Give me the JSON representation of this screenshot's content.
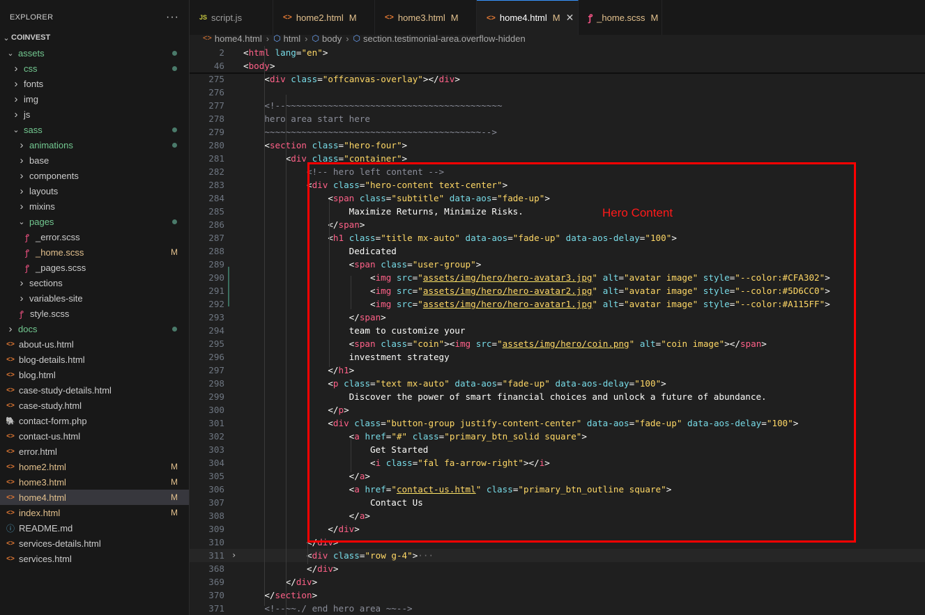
{
  "sidebar": {
    "title": "EXPLORER",
    "more": "···",
    "root": "COINVEST",
    "items": [
      {
        "label": "assets",
        "type": "folder-open",
        "depth": 1,
        "status": "dir-mod"
      },
      {
        "label": "css",
        "type": "folder",
        "depth": 2,
        "status": "dir-mod"
      },
      {
        "label": "fonts",
        "type": "folder",
        "depth": 2,
        "status": "plain"
      },
      {
        "label": "img",
        "type": "folder",
        "depth": 2,
        "status": "plain"
      },
      {
        "label": "js",
        "type": "folder",
        "depth": 2,
        "status": "plain"
      },
      {
        "label": "sass",
        "type": "folder-open",
        "depth": 2,
        "status": "dir-mod"
      },
      {
        "label": "animations",
        "type": "folder",
        "depth": 3,
        "status": "dir-mod"
      },
      {
        "label": "base",
        "type": "folder",
        "depth": 3,
        "status": "plain"
      },
      {
        "label": "components",
        "type": "folder",
        "depth": 3,
        "status": "plain"
      },
      {
        "label": "layouts",
        "type": "folder",
        "depth": 3,
        "status": "plain"
      },
      {
        "label": "mixins",
        "type": "folder",
        "depth": 3,
        "status": "plain"
      },
      {
        "label": "pages",
        "type": "folder-open",
        "depth": 3,
        "status": "dir-mod"
      },
      {
        "label": "_error.scss",
        "type": "scss",
        "depth": 4,
        "status": "plain"
      },
      {
        "label": "_home.scss",
        "type": "scss",
        "depth": 4,
        "status": "mod",
        "badge": "M"
      },
      {
        "label": "_pages.scss",
        "type": "scss",
        "depth": 4,
        "status": "plain"
      },
      {
        "label": "sections",
        "type": "folder",
        "depth": 3,
        "status": "plain"
      },
      {
        "label": "variables-site",
        "type": "folder",
        "depth": 3,
        "status": "plain"
      },
      {
        "label": "style.scss",
        "type": "scss",
        "depth": 3,
        "status": "plain"
      },
      {
        "label": "docs",
        "type": "folder",
        "depth": 1,
        "status": "dir-mod"
      },
      {
        "label": "about-us.html",
        "type": "html",
        "depth": 1,
        "status": "plain"
      },
      {
        "label": "blog-details.html",
        "type": "html",
        "depth": 1,
        "status": "plain"
      },
      {
        "label": "blog.html",
        "type": "html",
        "depth": 1,
        "status": "plain"
      },
      {
        "label": "case-study-details.html",
        "type": "html",
        "depth": 1,
        "status": "plain"
      },
      {
        "label": "case-study.html",
        "type": "html",
        "depth": 1,
        "status": "plain"
      },
      {
        "label": "contact-form.php",
        "type": "php",
        "depth": 1,
        "status": "plain"
      },
      {
        "label": "contact-us.html",
        "type": "html",
        "depth": 1,
        "status": "plain"
      },
      {
        "label": "error.html",
        "type": "html",
        "depth": 1,
        "status": "plain"
      },
      {
        "label": "home2.html",
        "type": "html",
        "depth": 1,
        "status": "mod",
        "badge": "M"
      },
      {
        "label": "home3.html",
        "type": "html",
        "depth": 1,
        "status": "mod",
        "badge": "M"
      },
      {
        "label": "home4.html",
        "type": "html",
        "depth": 1,
        "status": "mod",
        "badge": "M",
        "selected": true
      },
      {
        "label": "index.html",
        "type": "html",
        "depth": 1,
        "status": "mod",
        "badge": "M"
      },
      {
        "label": "README.md",
        "type": "info",
        "depth": 1,
        "status": "plain"
      },
      {
        "label": "services-details.html",
        "type": "html",
        "depth": 1,
        "status": "plain"
      },
      {
        "label": "services.html",
        "type": "html",
        "depth": 1,
        "status": "plain"
      }
    ]
  },
  "tabs": [
    {
      "label": "script.js",
      "icon": "JS",
      "modified": ""
    },
    {
      "label": "home2.html",
      "icon": "<>",
      "modified": "M"
    },
    {
      "label": "home3.html",
      "icon": "<>",
      "modified": "M"
    },
    {
      "label": "home4.html",
      "icon": "<>",
      "modified": "M",
      "active": true,
      "close": "✕"
    },
    {
      "label": "_home.scss",
      "icon": "scss",
      "modified": "M"
    }
  ],
  "breadcrumb": [
    "home4.html",
    "html",
    "body",
    "section.testimonial-area.overflow-hidden"
  ],
  "annotation": "Hero Content",
  "code_lines": [
    {
      "n": "2",
      "t": "<html lang=\"en\">",
      "sticky": true
    },
    {
      "n": "46",
      "t": "<body>",
      "sticky": true
    },
    {
      "n": "275",
      "t": "    <div class=\"offcanvas-overlay\"></div>"
    },
    {
      "n": "276",
      "t": ""
    },
    {
      "n": "277",
      "t": "    <!--~~~~~~~~~~~~~~~~~~~~~~~~~~~~~~~~~~~~~~~~~"
    },
    {
      "n": "278",
      "t": "    hero area start here"
    },
    {
      "n": "279",
      "t": "    ~~~~~~~~~~~~~~~~~~~~~~~~~~~~~~~~~~~~~~~~~-->"
    },
    {
      "n": "280",
      "t": "    <section class=\"hero-four\">"
    },
    {
      "n": "281",
      "t": "        <div class=\"container\">"
    },
    {
      "n": "282",
      "t": "            <!-- hero left content -->"
    },
    {
      "n": "283",
      "t": "            <div class=\"hero-content text-center\">"
    },
    {
      "n": "284",
      "t": "                <span class=\"subtitle\" data-aos=\"fade-up\">"
    },
    {
      "n": "285",
      "t": "                    Maximize Returns, Minimize Risks."
    },
    {
      "n": "286",
      "t": "                </span>"
    },
    {
      "n": "287",
      "t": "                <h1 class=\"title mx-auto\" data-aos=\"fade-up\" data-aos-delay=\"100\">"
    },
    {
      "n": "288",
      "t": "                    Dedicated"
    },
    {
      "n": "289",
      "t": "                    <span class=\"user-group\">"
    },
    {
      "n": "290",
      "t": "                        <img src=\"assets/img/hero/hero-avatar3.jpg\" alt=\"avatar image\" style=\"--color:#CFA302\">"
    },
    {
      "n": "291",
      "t": "                        <img src=\"assets/img/hero/hero-avatar2.jpg\" alt=\"avatar image\" style=\"--color:#5D6CC0\">"
    },
    {
      "n": "292",
      "t": "                        <img src=\"assets/img/hero/hero-avatar1.jpg\" alt=\"avatar image\" style=\"--color:#A115FF\">"
    },
    {
      "n": "293",
      "t": "                    </span>"
    },
    {
      "n": "294",
      "t": "                    team to customize your"
    },
    {
      "n": "295",
      "t": "                    <span class=\"coin\"><img src=\"assets/img/hero/coin.png\" alt=\"coin image\"></span>"
    },
    {
      "n": "296",
      "t": "                    investment strategy"
    },
    {
      "n": "297",
      "t": "                </h1>"
    },
    {
      "n": "298",
      "t": "                <p class=\"text mx-auto\" data-aos=\"fade-up\" data-aos-delay=\"100\">"
    },
    {
      "n": "299",
      "t": "                    Discover the power of smart financial choices and unlock a future of abundance."
    },
    {
      "n": "300",
      "t": "                </p>"
    },
    {
      "n": "301",
      "t": "                <div class=\"button-group justify-content-center\" data-aos=\"fade-up\" data-aos-delay=\"100\">"
    },
    {
      "n": "302",
      "t": "                    <a href=\"#\" class=\"primary_btn_solid square\">"
    },
    {
      "n": "303",
      "t": "                        Get Started"
    },
    {
      "n": "304",
      "t": "                        <i class=\"fal fa-arrow-right\"></i>"
    },
    {
      "n": "305",
      "t": "                    </a>"
    },
    {
      "n": "306",
      "t": "                    <a href=\"contact-us.html\" class=\"primary_btn_outline square\">"
    },
    {
      "n": "307",
      "t": "                        Contact Us"
    },
    {
      "n": "308",
      "t": "                    </a>"
    },
    {
      "n": "309",
      "t": "                </div>"
    },
    {
      "n": "310",
      "t": "            </div>"
    },
    {
      "n": "311",
      "t": "            <div class=\"row g-4\">···",
      "current": true,
      "folded": true
    },
    {
      "n": "368",
      "t": "            </div>"
    },
    {
      "n": "369",
      "t": "        </div>"
    },
    {
      "n": "370",
      "t": "    </section>"
    },
    {
      "n": "371",
      "t": "    <!--~~./ end hero area ~~-->"
    }
  ]
}
